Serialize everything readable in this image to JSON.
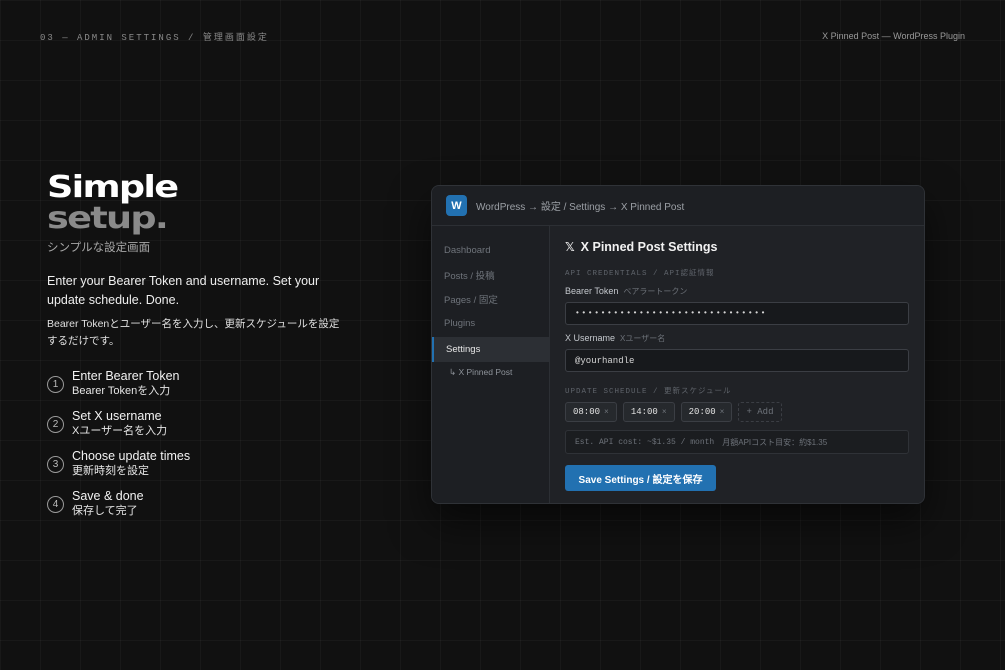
{
  "header": {
    "section": "03 — ADMIN SETTINGS / 管理画面設定",
    "product": "X Pinned Post — WordPress Plugin"
  },
  "hero": {
    "headline_line1": "Simple",
    "headline_line2": "setup.",
    "subtitle_jp": "シンプルな設定画面",
    "description_en": "Enter your Bearer Token and username. Set your update schedule. Done.",
    "description_jp": "Bearer Tokenとユーザー名を入力し、更新スケジュールを設定するだけです。"
  },
  "steps": [
    {
      "num": "1",
      "en": "Enter Bearer Token",
      "jp": "Bearer Tokenを入力"
    },
    {
      "num": "2",
      "en": "Set X username",
      "jp": "Xユーザー名を入力"
    },
    {
      "num": "3",
      "en": "Choose update times",
      "jp": "更新時刻を設定"
    },
    {
      "num": "4",
      "en": "Save & done",
      "jp": "保存して完了"
    }
  ],
  "window": {
    "logo": "W",
    "breadcrumb": "WordPress → 設定 / Settings → X Pinned Post",
    "sidebar": {
      "items": [
        "Dashboard",
        "Posts / 投稿",
        "Pages / 固定",
        "Plugins",
        "Settings"
      ],
      "sub_item": "↳ X Pinned Post"
    },
    "main": {
      "title": "X Pinned Post Settings",
      "credentials_label": "API CREDENTIALS / API認証情報",
      "token_label": "Bearer Token",
      "token_label_jp": "ベアラートークン",
      "token_value": "••••••••••••••••••••••••••••••",
      "username_label": "X Username",
      "username_label_jp": "Xユーザー名",
      "username_value": "@yourhandle",
      "schedule_label": "UPDATE SCHEDULE / 更新スケジュール",
      "times": [
        "08:00",
        "14:00",
        "20:00"
      ],
      "remove_glyph": "×",
      "add_label": "+ Add",
      "cost_en": "Est. API cost: ~$1.35 / month",
      "cost_jp": "月額APIコスト目安：約$1.35",
      "save_label": "Save Settings / 設定を保存"
    }
  },
  "colors": {
    "accent": "#2271b1",
    "background": "#111111"
  },
  "icons": {
    "x_logo": "x-logo-icon",
    "wordpress": "wordpress-logo-icon"
  }
}
